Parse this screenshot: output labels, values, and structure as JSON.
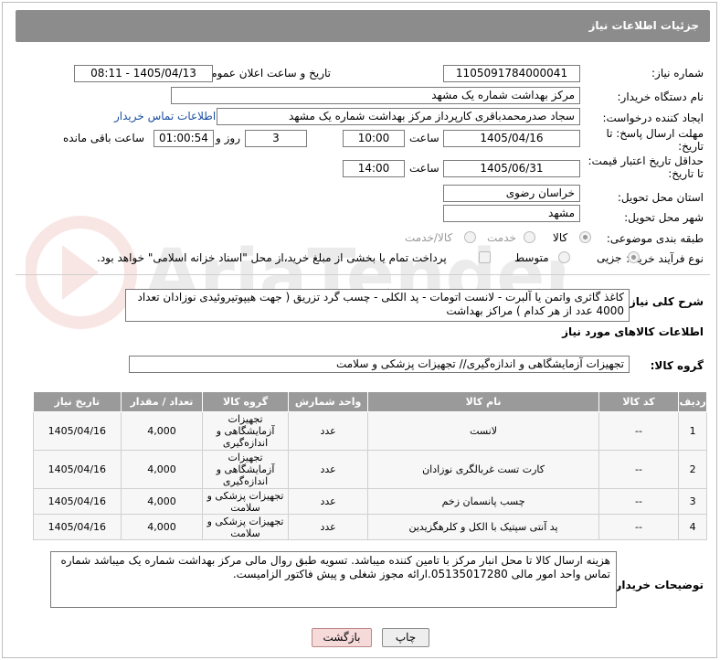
{
  "header": {
    "title": "جزئیات اطلاعات نیاز"
  },
  "form": {
    "need_number_label": "شماره نیاز:",
    "need_number": "1105091784000041",
    "announce_label": "تاریخ و ساعت اعلان عمومی:",
    "announce_value": "1405/04/13 - 08:11",
    "buyer_org_label": "نام دستگاه خریدار:",
    "buyer_org": "مرکز بهداشت شماره یک مشهد",
    "creator_label": "ایجاد کننده درخواست:",
    "creator": "سجاد صدرمحمدباقری کارپرداز مرکز بهداشت شماره یک مشهد",
    "contact_link": "اطلاعات تماس خریدار",
    "deadline_label_1": "مهلت ارسال پاسخ: تا",
    "deadline_label_2": "تاریخ:",
    "deadline_date": "1405/04/16",
    "time_label": "ساعت",
    "deadline_time": "10:00",
    "days_value": "3",
    "days_label": "روز و",
    "remaining_time": "01:00:54",
    "remaining_label": "ساعت باقی مانده",
    "validity_label_1": "حداقل تاریخ اعتبار قیمت:",
    "validity_label_2": "تا تاریخ:",
    "validity_date": "1405/06/31",
    "validity_time": "14:00",
    "province_label": "استان محل تحویل:",
    "province": "خراسان رضوی",
    "city_label": "شهر محل تحویل:",
    "city": "مشهد",
    "category_label": "طبقه بندی موضوعی:",
    "category_options": [
      "کالا",
      "خدمت",
      "کالا/خدمت"
    ],
    "category_selected": "کالا",
    "process_label": "نوع فرآیند خرید :",
    "process_options": [
      "جزیی",
      "متوسط"
    ],
    "process_selected": "جزیی",
    "payment_note": "پرداخت تمام یا بخشی از مبلغ خرید،از محل \"اسناد خزانه اسلامی\" خواهد بود."
  },
  "description": {
    "label": "شرح کلی نیاز:",
    "text": "کاغذ گاثری واتمن یا آلبرت - لانست اتومات - پد الکلی - چسب گرد تزریق  ( جهت هیپوتیروئیدی نوزادان تعداد 4000 عدد از هر کدام ) مراکز بهداشت"
  },
  "goods": {
    "section_title": "اطلاعات کالاهای مورد نیاز",
    "group_label": "گروه کالا:",
    "group_value": "تجهیزات آزمایشگاهی و اندازه‌گیری// تجهیزات پزشکی و سلامت",
    "columns": [
      "ردیف",
      "کد کالا",
      "نام کالا",
      "واحد شمارش",
      "گروه کالا",
      "تعداد / مقدار",
      "تاریخ نیاز"
    ],
    "rows": [
      {
        "idx": "1",
        "code": "--",
        "name": "لانست",
        "unit": "عدد",
        "group": "تجهیزات آزمایشگاهی و اندازه‌گیری",
        "qty": "4,000",
        "date": "1405/04/16"
      },
      {
        "idx": "2",
        "code": "--",
        "name": "کارت تست غربالگری نوزادان",
        "unit": "عدد",
        "group": "تجهیزات آزمایشگاهی و اندازه‌گیری",
        "qty": "4,000",
        "date": "1405/04/16"
      },
      {
        "idx": "3",
        "code": "--",
        "name": "چسب پانسمان زخم",
        "unit": "عدد",
        "group": "تجهیزات پزشکی و سلامت",
        "qty": "4,000",
        "date": "1405/04/16"
      },
      {
        "idx": "4",
        "code": "--",
        "name": "پد آنتی سپتیک با الکل و کلرهگزیدین",
        "unit": "عدد",
        "group": "تجهیزات پزشکی و سلامت",
        "qty": "4,000",
        "date": "1405/04/16"
      }
    ]
  },
  "notes": {
    "label": "توضیحات خریدار:",
    "text": "هزینه ارسال کالا تا محل انبار مرکز با تامین کننده میباشد. تسویه طبق روال مالی مرکز بهداشت شماره یک میباشد شماره تماس واحد امور مالی 05135017280.ارائه مجوز شغلی و پیش فاکتور الزامیست."
  },
  "buttons": {
    "print": "چاپ",
    "back": "بازگشت"
  },
  "watermark": {
    "text": "AriaTender.net"
  }
}
